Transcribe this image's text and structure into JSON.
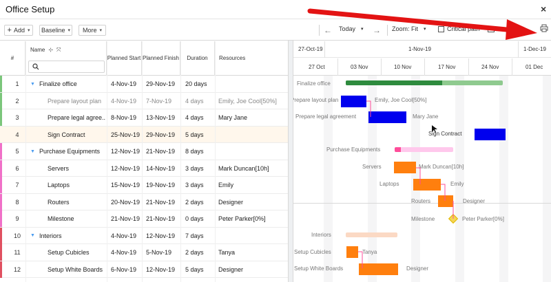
{
  "window": {
    "title": "Office Setup",
    "close_glyph": "×"
  },
  "toolbar": {
    "add_label": "Add",
    "baseline_label": "Baseline",
    "more_label": "More",
    "today_label": "Today",
    "zoom_label": "Zoom: Fit",
    "critical_path_label": "Critical path",
    "print_icon": "printer-icon"
  },
  "grid": {
    "columns": {
      "num": "#",
      "name": "Name",
      "planned_start": "Planned Start",
      "planned_finish": "Planned Finish",
      "duration": "Duration",
      "resources": "Resources"
    }
  },
  "rows": [
    {
      "num": "1",
      "name": "Finalize office",
      "start": "4-Nov-19",
      "finish": "29-Nov-19",
      "duration": "20 days",
      "resources": "",
      "summary": true,
      "color": "#7bc67b",
      "dim": false
    },
    {
      "num": "2",
      "name": "Prepare layout plan",
      "start": "4-Nov-19",
      "finish": "7-Nov-19",
      "duration": "4 days",
      "resources": "Emily, Joe Cool[50%]",
      "summary": false,
      "color": "#7bc67b",
      "dim": true
    },
    {
      "num": "3",
      "name": "Prepare legal agree...",
      "start": "8-Nov-19",
      "finish": "13-Nov-19",
      "duration": "4 days",
      "resources": "Mary Jane",
      "summary": false,
      "color": "#7bc67b",
      "dim": false
    },
    {
      "num": "4",
      "name": "Sign Contract",
      "start": "25-Nov-19",
      "finish": "29-Nov-19",
      "duration": "5 days",
      "resources": "",
      "summary": false,
      "color": "",
      "dim": false,
      "highlight": true
    },
    {
      "num": "5",
      "name": "Purchase Equipments",
      "start": "12-Nov-19",
      "finish": "21-Nov-19",
      "duration": "8 days",
      "resources": "",
      "summary": true,
      "color": "#f070c8",
      "dim": false
    },
    {
      "num": "6",
      "name": "Servers",
      "start": "12-Nov-19",
      "finish": "14-Nov-19",
      "duration": "3 days",
      "resources": "Mark Duncan[10h]",
      "summary": false,
      "color": "#f070c8",
      "dim": false
    },
    {
      "num": "7",
      "name": "Laptops",
      "start": "15-Nov-19",
      "finish": "19-Nov-19",
      "duration": "3 days",
      "resources": "Emily",
      "summary": false,
      "color": "#f070c8",
      "dim": false
    },
    {
      "num": "8",
      "name": "Routers",
      "start": "20-Nov-19",
      "finish": "21-Nov-19",
      "duration": "2 days",
      "resources": "Designer",
      "summary": false,
      "color": "#f070c8",
      "dim": false
    },
    {
      "num": "9",
      "name": "Milestone",
      "start": "21-Nov-19",
      "finish": "21-Nov-19",
      "duration": "0 days",
      "resources": "Peter Parker[0%]",
      "summary": false,
      "color": "#f070c8",
      "dim": false
    },
    {
      "num": "10",
      "name": "Interiors",
      "start": "4-Nov-19",
      "finish": "12-Nov-19",
      "duration": "7 days",
      "resources": "",
      "summary": true,
      "color": "#e05060",
      "dim": false
    },
    {
      "num": "11",
      "name": "Setup Cubicles",
      "start": "4-Nov-19",
      "finish": "5-Nov-19",
      "duration": "2 days",
      "resources": "Tanya",
      "summary": false,
      "color": "#e05060",
      "dim": false
    },
    {
      "num": "12",
      "name": "Setup White Boards",
      "start": "6-Nov-19",
      "finish": "12-Nov-19",
      "duration": "5 days",
      "resources": "Designer",
      "summary": false,
      "color": "#e05060",
      "dim": false
    }
  ],
  "timeline": {
    "months": [
      "27-Oct-19",
      "1-Nov-19",
      "1-Dec-19"
    ],
    "weeks": [
      "27 Oct",
      "03 Nov",
      "10 Nov",
      "17 Nov",
      "24 Nov",
      "01 Dec"
    ]
  },
  "gantt": {
    "task_labels": [
      "Finalize office",
      "Prepare layout plan",
      "Prepare legal agreement",
      "Sign Contract",
      "Purchase Equipments",
      "Servers",
      "Laptops",
      "Routers",
      "Milestone",
      "Interiors",
      "Setup Cubicles",
      "Setup White Boards"
    ],
    "resource_labels": [
      "Emily, Joe Cool[50%]",
      "Mary Jane",
      "Mark Duncan[10h]",
      "Emily",
      "Designer",
      "Peter Parker[0%]",
      "Tanya",
      "Designer"
    ],
    "colors": {
      "summary_green": "#2e8b3e",
      "summary_green_light": "#8fca8f",
      "blue": "#0000ee",
      "orange": "#ff7f0e",
      "pink": "#ffc8ec",
      "pink_dark": "#ff4d9a",
      "peach": "#fbd9c4",
      "milestone": "#f5d556"
    }
  }
}
